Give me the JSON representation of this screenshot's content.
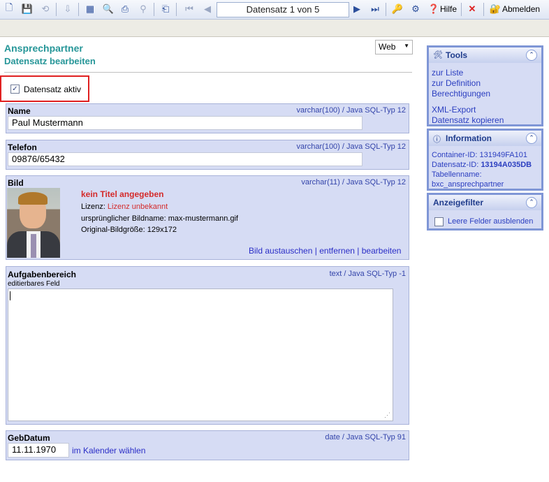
{
  "toolbar": {
    "record_label": "Datensatz 1 von 5",
    "help_label": "Hilfe",
    "logout_label": "Abmelden",
    "colors": {
      "accent": "#2c4f9c"
    }
  },
  "header": {
    "title": "Ansprechpartner",
    "subtitle": "Datensatz bearbeiten",
    "view_option": "Web"
  },
  "active": {
    "label": "Datensatz aktiv",
    "checked": true
  },
  "fields": {
    "name": {
      "label": "Name",
      "type": "varchar(100) / Java SQL-Typ 12",
      "value": "Paul Mustermann"
    },
    "phone": {
      "label": "Telefon",
      "type": "varchar(100) / Java SQL-Typ 12",
      "value": "09876/65432"
    },
    "image": {
      "label": "Bild",
      "type": "varchar(11) / Java SQL-Typ 12",
      "no_title": "kein Titel angegeben",
      "license_prefix": "Lizenz:",
      "license_value": "Lizenz unbekannt",
      "original_name": "ursprünglicher Bildname: max-mustermann.gif",
      "original_size": "Original-Bildgröße: 129x172",
      "replace_link": "Bild austauschen",
      "remove_link": "entfernen",
      "edit_link": "bearbeiten",
      "sep": "|"
    },
    "tasks": {
      "label": "Aufgabenbereich",
      "type": "text / Java SQL-Typ -1",
      "hint": "editierbares Feld",
      "value": ""
    },
    "birthday": {
      "label": "GebDatum",
      "type": "date / Java SQL-Typ 91",
      "value": "11.11.1970",
      "calendar_link": "im Kalender wählen"
    }
  },
  "sidebar": {
    "tools": {
      "title": "Tools",
      "links": [
        "zur Liste",
        "zur Definition",
        "Berechtigungen",
        "XML-Export",
        "Datensatz kopieren"
      ]
    },
    "info": {
      "title": "Information",
      "container_label": "Container-ID:",
      "container_id": "131949FA101",
      "record_label": "Datensatz-ID:",
      "record_id": "13194A035DB",
      "table_label": "Tabellenname:",
      "table_name": "bxc_ansprechpartner"
    },
    "filter": {
      "title": "Anzeigefilter",
      "hide_empty_label": "Leere Felder ausblenden",
      "checked": false
    }
  }
}
